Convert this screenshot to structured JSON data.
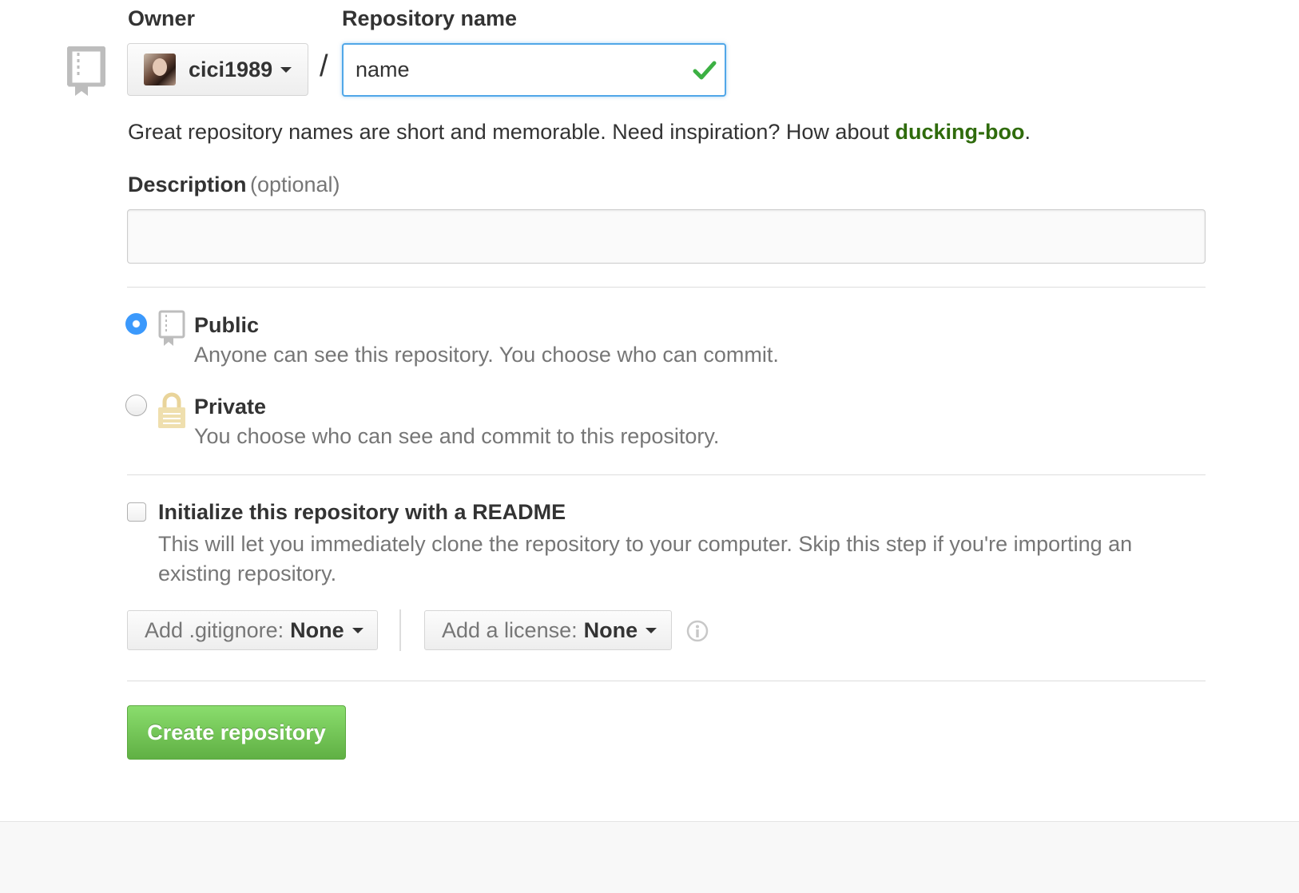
{
  "owner": {
    "label": "Owner",
    "username": "cici1989"
  },
  "repository_name": {
    "label": "Repository name",
    "value": "name",
    "separator": "/",
    "valid": true
  },
  "hint": {
    "text": "Great repository names are short and memorable. Need inspiration? How about ",
    "suggestion": "ducking-boo",
    "suffix": "."
  },
  "description": {
    "label": "Description",
    "optional": "(optional)",
    "value": ""
  },
  "visibility": {
    "selected": "public",
    "options": [
      {
        "title": "Public",
        "description": "Anyone can see this repository. You choose who can commit.",
        "icon": "repo-icon"
      },
      {
        "title": "Private",
        "description": "You choose who can see and commit to this repository.",
        "icon": "lock-icon"
      }
    ]
  },
  "readme": {
    "checked": false,
    "title": "Initialize this repository with a README",
    "description": "This will let you immediately clone the repository to your computer. Skip this step if you're importing an existing repository."
  },
  "gitignore": {
    "prefix": "Add .gitignore:",
    "value": "None"
  },
  "license": {
    "prefix": "Add a license:",
    "value": "None"
  },
  "create_button": {
    "label": "Create repository"
  },
  "colors": {
    "accent_blue": "#51a7e8",
    "success_green": "#60b044",
    "suggestion_green": "#2f6b0c",
    "lock_gold": "#e9d49a"
  }
}
